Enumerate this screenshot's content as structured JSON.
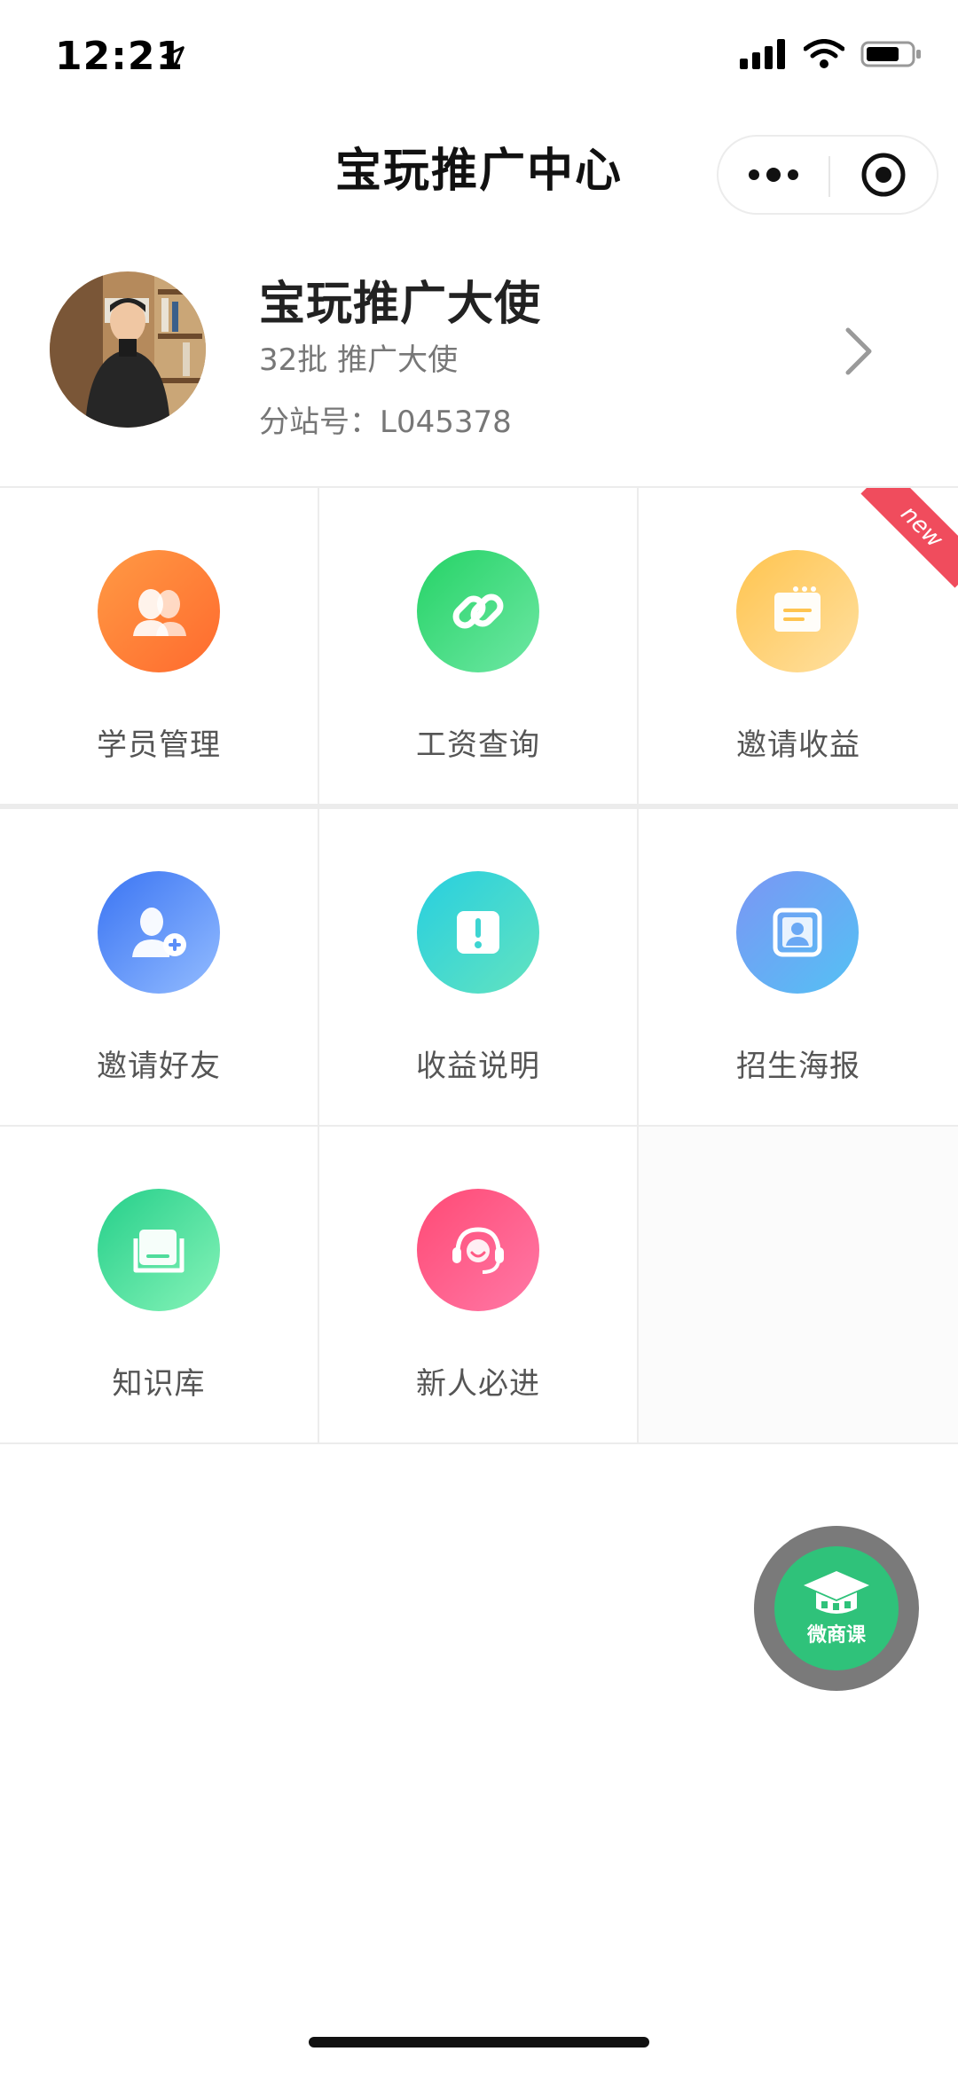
{
  "status_bar": {
    "time": "12:21"
  },
  "nav": {
    "title": "宝玩推广中心"
  },
  "profile": {
    "name": "宝玩推广大使",
    "subtitle": "32批 推广大使",
    "branch": "分站号：L045378"
  },
  "grid": [
    {
      "label": "学员管理",
      "icon": "students-icon",
      "color_from": "#ff8f3a",
      "color_to": "#ff6a2e"
    },
    {
      "label": "工资查询",
      "icon": "link-icon",
      "color_from": "#2ed573",
      "color_to": "#5fe39b"
    },
    {
      "label": "邀请收益",
      "icon": "folder-icon",
      "color_from": "#ffd35f",
      "color_to": "#ffb24d",
      "badge": "new"
    },
    {
      "label": "邀请好友",
      "icon": "add-user-icon",
      "color_from": "#3f7cf6",
      "color_to": "#8ab3ff"
    },
    {
      "label": "收益说明",
      "icon": "alert-icon",
      "color_from": "#2fd3d8",
      "color_to": "#5ee0c1"
    },
    {
      "label": "招生海报",
      "icon": "poster-icon",
      "color_from": "#7aa0f5",
      "color_to": "#58b8f5"
    },
    {
      "label": "知识库",
      "icon": "book-icon",
      "color_from": "#2fd38f",
      "color_to": "#7ff0b5"
    },
    {
      "label": "新人必进",
      "icon": "headset-icon",
      "color_from": "#ff4f7a",
      "color_to": "#ff6fa0"
    }
  ],
  "float_button": {
    "label": "微商课",
    "icon": "graduation-cap-icon"
  }
}
